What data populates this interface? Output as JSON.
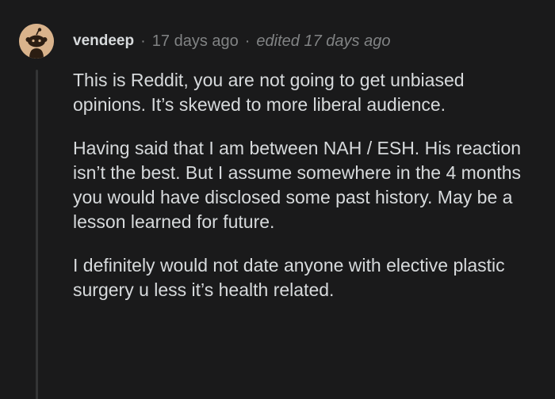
{
  "comment": {
    "author": {
      "username": "vendeep",
      "avatar_icon": "reddit-snoo-avatar-icon"
    },
    "timestamp": "17 days ago",
    "edited_label": "edited 17 days ago",
    "separator": "·",
    "paragraphs": [
      "This is Reddit, you are not going to get unbiased opinions. It’s skewed to more liberal audience.",
      "Having said that I am between NAH / ESH. His reaction isn’t the best. But I assume somewhere in the 4 months you would have disclosed some past history. May be a lesson learned for future.",
      "I definitely would not date anyone with elective plastic surgery u less it’s health related."
    ]
  },
  "colors": {
    "background": "#1a1a1b",
    "text": "#d7dadc",
    "meta_text": "#818384",
    "thread_line": "#343536",
    "avatar_bg": "#d9b38c"
  }
}
